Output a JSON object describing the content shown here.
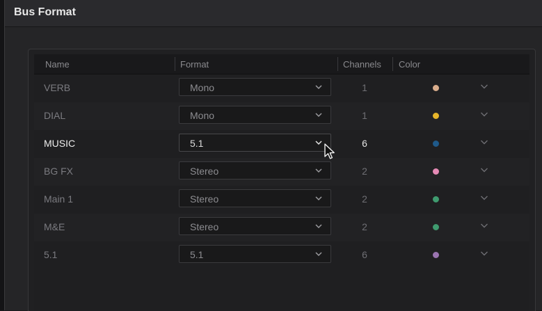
{
  "dialog": {
    "title": "Bus Format"
  },
  "table": {
    "columns": {
      "name": "Name",
      "format": "Format",
      "channels": "Channels",
      "color": "Color"
    },
    "rows": [
      {
        "name": "VERB",
        "format": "Mono",
        "channels": "1",
        "color": "#d9ad8c",
        "active": false
      },
      {
        "name": "DIAL",
        "format": "Mono",
        "channels": "1",
        "color": "#e6b52a",
        "active": false
      },
      {
        "name": "MUSIC",
        "format": "5.1",
        "channels": "6",
        "color": "#1f5a8a",
        "active": true
      },
      {
        "name": "BG FX",
        "format": "Stereo",
        "channels": "2",
        "color": "#e58ab5",
        "active": false
      },
      {
        "name": "Main 1",
        "format": "Stereo",
        "channels": "2",
        "color": "#3f9b6f",
        "active": false
      },
      {
        "name": "M&E",
        "format": "Stereo",
        "channels": "2",
        "color": "#3f9b6f",
        "active": false
      },
      {
        "name": "5.1",
        "format": "5.1",
        "channels": "6",
        "color": "#9a74b0",
        "active": false
      }
    ]
  },
  "icons": {
    "dropdown": "chevron-down-icon",
    "cursor": "mouse-pointer-icon"
  }
}
